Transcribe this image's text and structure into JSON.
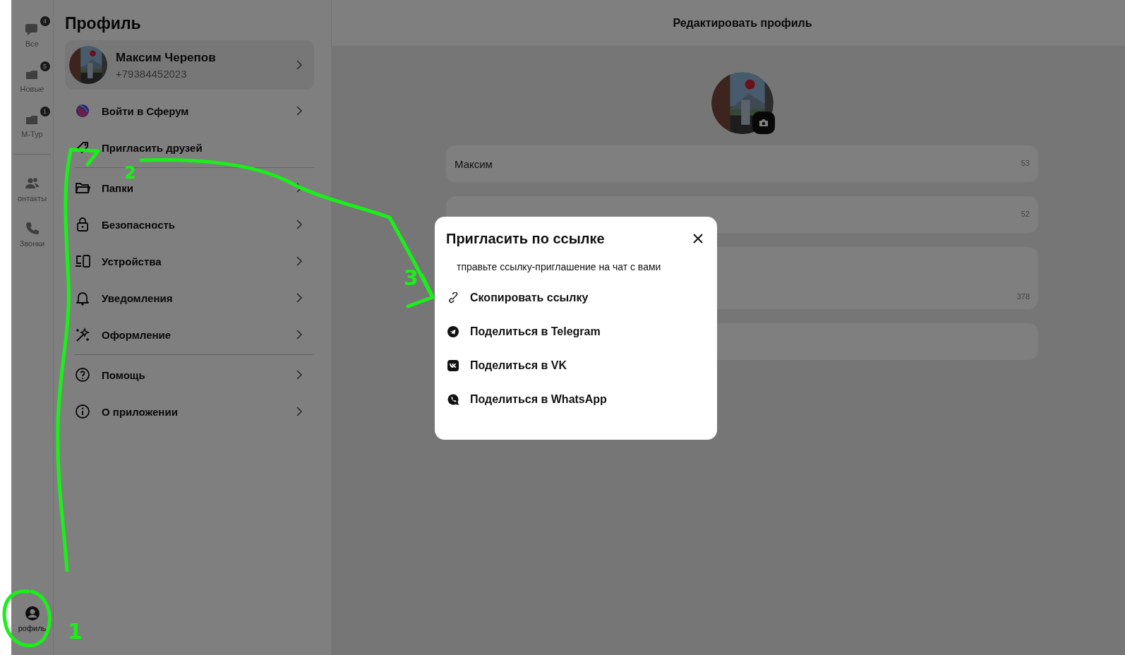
{
  "rail": {
    "items": [
      {
        "label": "Все",
        "badge": "4",
        "selected": false
      },
      {
        "label": "Новые",
        "badge": "5",
        "selected": false
      },
      {
        "label": "М-Тур",
        "badge": "1",
        "selected": false
      },
      {
        "label": "онтакты",
        "selected": false
      },
      {
        "label": "Звонки",
        "selected": false
      }
    ],
    "bottom": {
      "label": "рофиль",
      "selected": true
    }
  },
  "profile": {
    "title": "Профиль",
    "user": {
      "name": "Максим Черепов",
      "phone": "+79384452023"
    },
    "sections": [
      [
        {
          "label": "Войти в Сферум",
          "chevron": true
        },
        {
          "label": "Пригласить друзей",
          "chevron": false
        }
      ],
      [
        {
          "label": "Папки",
          "chevron": true
        },
        {
          "label": "Безопасность",
          "chevron": true
        },
        {
          "label": "Устройства",
          "chevron": true
        },
        {
          "label": "Уведомления",
          "chevron": true
        },
        {
          "label": "Оформление",
          "chevron": true
        }
      ],
      [
        {
          "label": "Помощь",
          "chevron": true
        },
        {
          "label": "О приложении",
          "chevron": true
        }
      ]
    ]
  },
  "editor": {
    "title": "Редактировать профиль",
    "fields": [
      {
        "value": "Максим",
        "counter": "53",
        "kind": "line"
      },
      {
        "counter": "52",
        "kind": "line"
      },
      {
        "counter": "378",
        "kind": "area"
      },
      {
        "kind": "line"
      }
    ]
  },
  "dialog": {
    "title": "Пригласить по ссылке",
    "text": "тправьте ссылку-приглашение на чат с вами",
    "actions": [
      {
        "label": "Скопировать ссылку"
      },
      {
        "label": "Поделиться в Telegram"
      },
      {
        "label": "Поделиться в VK"
      },
      {
        "label": "Поделиться в WhatsApp"
      }
    ]
  },
  "annotations": [
    {
      "label": "1"
    },
    {
      "label": "2"
    },
    {
      "label": "3"
    }
  ]
}
